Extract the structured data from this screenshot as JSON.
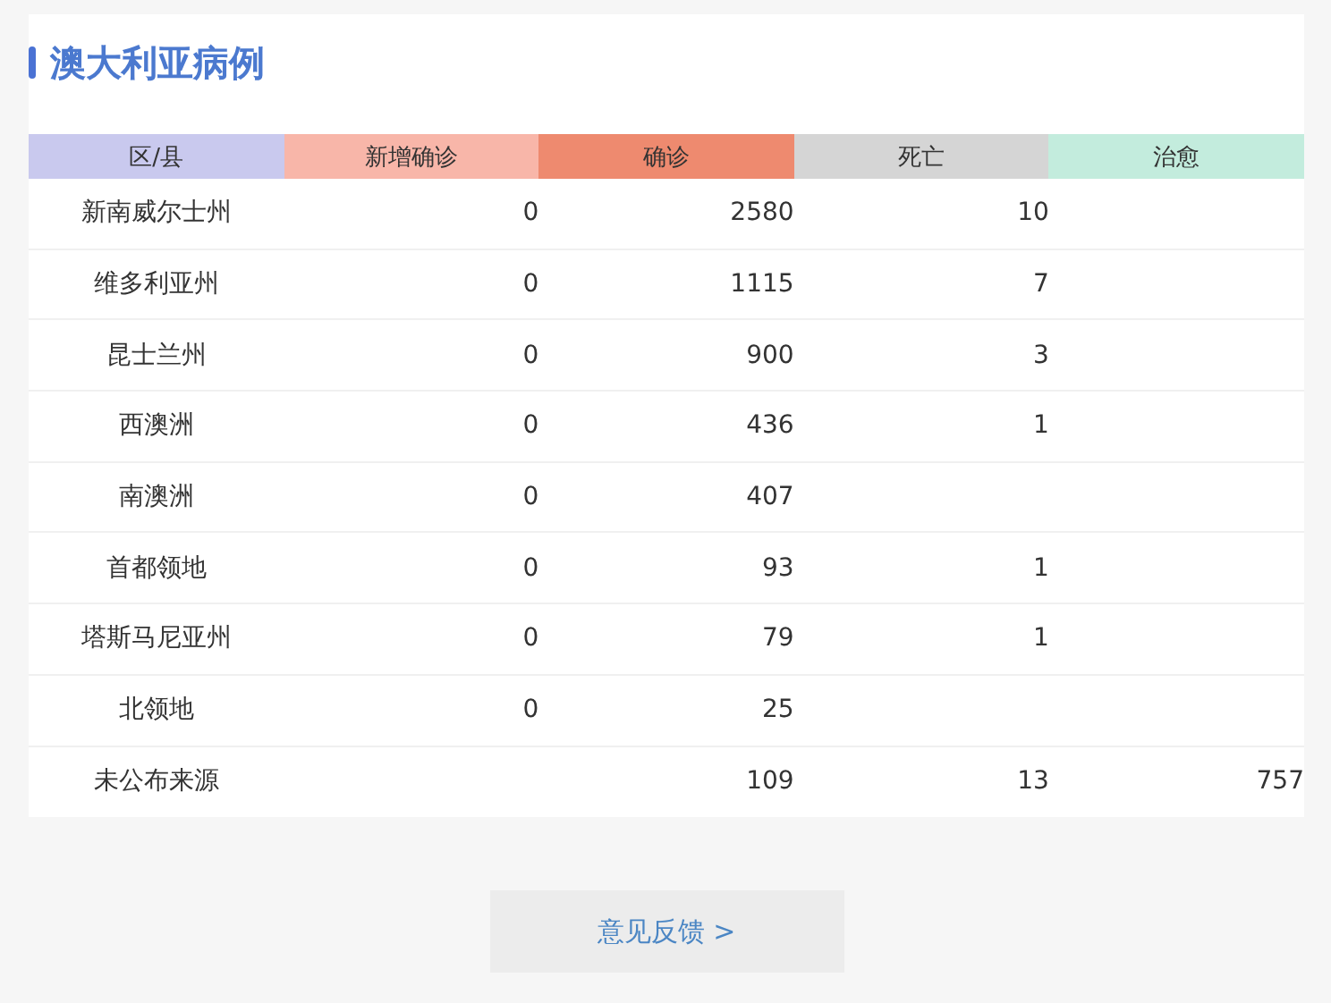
{
  "title": "澳大利亚病例",
  "table": {
    "columns": [
      {
        "label": "区/县",
        "color": "#c9c9ee"
      },
      {
        "label": "新增确诊",
        "color": "#f8b6a9"
      },
      {
        "label": "确诊",
        "color": "#ee8a6f"
      },
      {
        "label": "死亡",
        "color": "#d5d5d5"
      },
      {
        "label": "治愈",
        "color": "#c3ecdd"
      }
    ],
    "rows": [
      [
        "新南威尔士州",
        "0",
        "2580",
        "10",
        ""
      ],
      [
        "维多利亚州",
        "0",
        "1115",
        "7",
        ""
      ],
      [
        "昆士兰州",
        "0",
        "900",
        "3",
        ""
      ],
      [
        "西澳洲",
        "0",
        "436",
        "1",
        ""
      ],
      [
        "南澳洲",
        "0",
        "407",
        "",
        ""
      ],
      [
        "首都领地",
        "0",
        "93",
        "1",
        ""
      ],
      [
        "塔斯马尼亚州",
        "0",
        "79",
        "1",
        ""
      ],
      [
        "北领地",
        "0",
        "25",
        "",
        ""
      ],
      [
        "未公布来源",
        "",
        "109",
        "13",
        "757"
      ]
    ]
  },
  "feedback_button": "意见反馈 >"
}
